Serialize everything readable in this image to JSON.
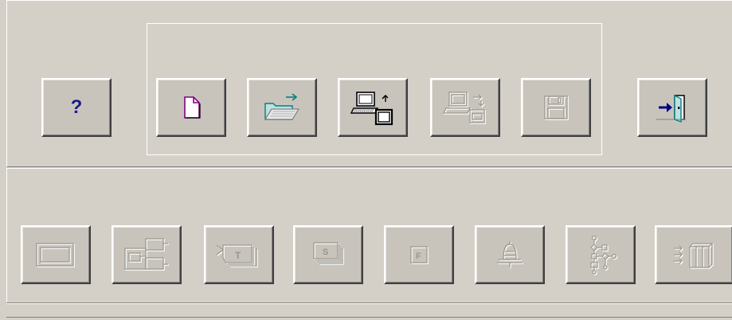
{
  "toolbar_top": {
    "buttons": [
      {
        "id": "help",
        "icon": "help-question-icon",
        "label": "?",
        "enabled": true
      },
      {
        "id": "new",
        "icon": "new-document-icon",
        "enabled": true
      },
      {
        "id": "open",
        "icon": "open-folder-icon",
        "enabled": true
      },
      {
        "id": "connect",
        "icon": "computer-connect-icon",
        "enabled": true
      },
      {
        "id": "transfer",
        "icon": "computer-transfer-icon",
        "enabled": false
      },
      {
        "id": "save",
        "icon": "floppy-disk-icon",
        "enabled": false
      },
      {
        "id": "exit",
        "icon": "exit-door-icon",
        "enabled": true
      }
    ]
  },
  "toolbar_bottom": {
    "buttons": [
      {
        "id": "frame",
        "icon": "frame-rectangle-icon",
        "enabled": false
      },
      {
        "id": "diagram",
        "icon": "block-diagram-icon",
        "enabled": false
      },
      {
        "id": "text",
        "icon": "text-tag-icon",
        "label": "T",
        "enabled": false
      },
      {
        "id": "stack",
        "icon": "stack-pages-icon",
        "label": "S",
        "enabled": false
      },
      {
        "id": "field",
        "icon": "field-box-icon",
        "label": "F",
        "enabled": false
      },
      {
        "id": "alarm",
        "icon": "bell-icon",
        "enabled": false
      },
      {
        "id": "flowchart",
        "icon": "flowchart-icon",
        "enabled": false
      },
      {
        "id": "sequence",
        "icon": "sequence-bars-icon",
        "enabled": false
      }
    ]
  },
  "colors": {
    "face": "#d4d0c8",
    "button_face": "#c8c4bc",
    "disabled_glyph": "#ffffff",
    "disabled_shadow": "#9a968e",
    "accent_blue": "#000080",
    "accent_teal": "#008080",
    "accent_purple": "#800080"
  }
}
